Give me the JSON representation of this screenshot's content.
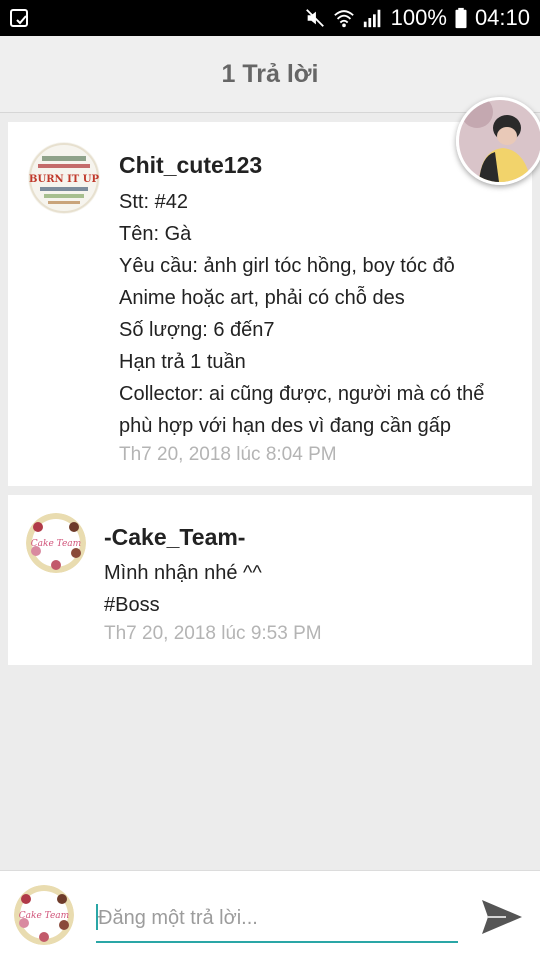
{
  "status_bar": {
    "battery": "100%",
    "time": "04:10"
  },
  "header": {
    "title": "1 Trả lời"
  },
  "posts": [
    {
      "author": "Chit_cute123",
      "lines": [
        "Stt: #42",
        "Tên: Gà",
        "Yêu cầu: ảnh girl tóc hồng, boy tóc đỏ",
        "Anime hoặc art, phải có chỗ des",
        "Số lượng: 6 đến7",
        "Hạn trả 1 tuần",
        "Collector: ai cũng được, người mà có thể",
        "phù hợp với hạn des vì đang cần gấp"
      ],
      "timestamp": "Th7 20, 2018 lúc 8:04 PM",
      "avatar_text": "BURN IT UP"
    },
    {
      "author": "-Cake_Team-",
      "lines": [
        "Mình nhận nhé ^^",
        "#Boss"
      ],
      "timestamp": "Th7 20, 2018 lúc 9:53 PM",
      "avatar_text": "Cake Team"
    }
  ],
  "reply": {
    "placeholder": "Đăng một trả lời...",
    "avatar_text": "Cake Team"
  },
  "icons": {
    "status_left": "screenshot-icon",
    "mute": "mute-icon",
    "wifi": "wifi-icon",
    "signal": "signal-icon",
    "battery": "battery-icon",
    "send": "send-icon"
  },
  "colors": {
    "accent": "#2aa6a6",
    "timestamp": "#b4b4b4",
    "header_text": "#666666"
  }
}
